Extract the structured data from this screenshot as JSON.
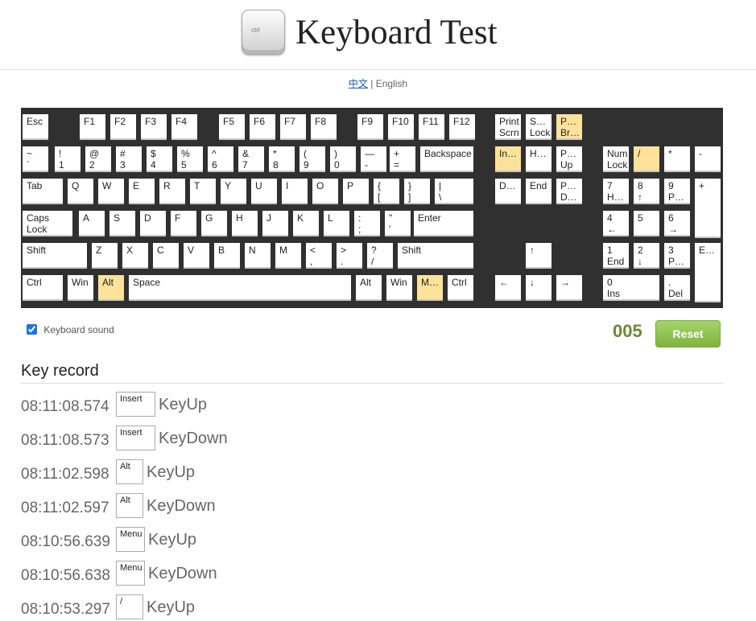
{
  "header": {
    "title": "Keyboard Test",
    "logo_label": "ctrl"
  },
  "lang": {
    "chinese": "中文",
    "separator": "|",
    "english": "English"
  },
  "keys": [
    {
      "id": "esc",
      "l1": "Esc",
      "l2": "",
      "hl": false
    },
    {
      "id": "f1",
      "l1": "F1",
      "l2": "",
      "hl": false
    },
    {
      "id": "f2",
      "l1": "F2",
      "l2": "",
      "hl": false
    },
    {
      "id": "f3",
      "l1": "F3",
      "l2": "",
      "hl": false
    },
    {
      "id": "f4",
      "l1": "F4",
      "l2": "",
      "hl": false
    },
    {
      "id": "f5",
      "l1": "F5",
      "l2": "",
      "hl": false
    },
    {
      "id": "f6",
      "l1": "F6",
      "l2": "",
      "hl": false
    },
    {
      "id": "f7",
      "l1": "F7",
      "l2": "",
      "hl": false
    },
    {
      "id": "f8",
      "l1": "F8",
      "l2": "",
      "hl": false
    },
    {
      "id": "f9",
      "l1": "F9",
      "l2": "",
      "hl": false
    },
    {
      "id": "f10",
      "l1": "F10",
      "l2": "",
      "hl": false
    },
    {
      "id": "f11",
      "l1": "F11",
      "l2": "",
      "hl": false
    },
    {
      "id": "f12",
      "l1": "F12",
      "l2": "",
      "hl": false
    },
    {
      "id": "print-screen",
      "l1": "Print",
      "l2": "Scrn",
      "hl": false
    },
    {
      "id": "scroll-lock",
      "l1": "S…",
      "l2": "Lock",
      "hl": false
    },
    {
      "id": "pause-break",
      "l1": "P…",
      "l2": "Br…",
      "hl": true
    },
    {
      "id": "backtick",
      "l1": "~",
      "l2": "`",
      "hl": false
    },
    {
      "id": "digit-1",
      "l1": "!",
      "l2": "1",
      "hl": false
    },
    {
      "id": "digit-2",
      "l1": "@",
      "l2": "2",
      "hl": false
    },
    {
      "id": "digit-3",
      "l1": "#",
      "l2": "3",
      "hl": false
    },
    {
      "id": "digit-4",
      "l1": "$",
      "l2": "4",
      "hl": false
    },
    {
      "id": "digit-5",
      "l1": "%",
      "l2": "5",
      "hl": false
    },
    {
      "id": "digit-6",
      "l1": "^",
      "l2": "6",
      "hl": false
    },
    {
      "id": "digit-7",
      "l1": "&",
      "l2": "7",
      "hl": false
    },
    {
      "id": "digit-8",
      "l1": "*",
      "l2": "8",
      "hl": false
    },
    {
      "id": "digit-9",
      "l1": "(",
      "l2": "9",
      "hl": false
    },
    {
      "id": "digit-0",
      "l1": ")",
      "l2": "0",
      "hl": false
    },
    {
      "id": "minus",
      "l1": "—",
      "l2": "-",
      "hl": false
    },
    {
      "id": "equal",
      "l1": "+",
      "l2": "=",
      "hl": false
    },
    {
      "id": "backspace",
      "l1": "Backspace",
      "l2": "",
      "hl": false
    },
    {
      "id": "insert",
      "l1": "In…",
      "l2": "",
      "hl": true
    },
    {
      "id": "home",
      "l1": "H…",
      "l2": "",
      "hl": false
    },
    {
      "id": "page-up",
      "l1": "P…",
      "l2": "Up",
      "hl": false
    },
    {
      "id": "num-lock",
      "l1": "Num",
      "l2": "Lock",
      "hl": false
    },
    {
      "id": "numpad-divide",
      "l1": "/",
      "l2": "",
      "hl": true
    },
    {
      "id": "numpad-multiply",
      "l1": "*",
      "l2": "",
      "hl": false
    },
    {
      "id": "numpad-subtract",
      "l1": "-",
      "l2": "",
      "hl": false
    },
    {
      "id": "tab",
      "l1": "Tab",
      "l2": "",
      "hl": false
    },
    {
      "id": "q",
      "l1": "Q",
      "l2": "",
      "hl": false
    },
    {
      "id": "w",
      "l1": "W",
      "l2": "",
      "hl": false
    },
    {
      "id": "e",
      "l1": "E",
      "l2": "",
      "hl": false
    },
    {
      "id": "r",
      "l1": "R",
      "l2": "",
      "hl": false
    },
    {
      "id": "t",
      "l1": "T",
      "l2": "",
      "hl": false
    },
    {
      "id": "y",
      "l1": "Y",
      "l2": "",
      "hl": false
    },
    {
      "id": "u",
      "l1": "U",
      "l2": "",
      "hl": false
    },
    {
      "id": "i",
      "l1": "I",
      "l2": "",
      "hl": false
    },
    {
      "id": "o",
      "l1": "O",
      "l2": "",
      "hl": false
    },
    {
      "id": "p",
      "l1": "P",
      "l2": "",
      "hl": false
    },
    {
      "id": "bracket-left",
      "l1": "{",
      "l2": "[",
      "hl": false
    },
    {
      "id": "bracket-right",
      "l1": "}",
      "l2": "]",
      "hl": false
    },
    {
      "id": "backslash",
      "l1": "|",
      "l2": "\\",
      "hl": false
    },
    {
      "id": "delete",
      "l1": "D…",
      "l2": "",
      "hl": false
    },
    {
      "id": "end",
      "l1": "End",
      "l2": "",
      "hl": false
    },
    {
      "id": "page-down",
      "l1": "P…",
      "l2": "D…",
      "hl": false
    },
    {
      "id": "numpad-7",
      "l1": "7",
      "l2": "H…",
      "hl": false
    },
    {
      "id": "numpad-8",
      "l1": "8",
      "l2": "↑",
      "hl": false
    },
    {
      "id": "numpad-9",
      "l1": "9",
      "l2": "P…",
      "hl": false
    },
    {
      "id": "numpad-add",
      "l1": "+",
      "l2": "",
      "hl": false
    },
    {
      "id": "caps-lock",
      "l1": "Caps",
      "l2": "Lock",
      "hl": false
    },
    {
      "id": "a",
      "l1": "A",
      "l2": "",
      "hl": false
    },
    {
      "id": "s",
      "l1": "S",
      "l2": "",
      "hl": false
    },
    {
      "id": "d",
      "l1": "D",
      "l2": "",
      "hl": false
    },
    {
      "id": "f",
      "l1": "F",
      "l2": "",
      "hl": false
    },
    {
      "id": "g",
      "l1": "G",
      "l2": "",
      "hl": false
    },
    {
      "id": "h",
      "l1": "H",
      "l2": "",
      "hl": false
    },
    {
      "id": "j",
      "l1": "J",
      "l2": "",
      "hl": false
    },
    {
      "id": "k",
      "l1": "K",
      "l2": "",
      "hl": false
    },
    {
      "id": "l",
      "l1": "L",
      "l2": "",
      "hl": false
    },
    {
      "id": "semicolon",
      "l1": ":",
      "l2": ";",
      "hl": false
    },
    {
      "id": "quote",
      "l1": "\"",
      "l2": "'",
      "hl": false
    },
    {
      "id": "enter",
      "l1": "Enter",
      "l2": "",
      "hl": false
    },
    {
      "id": "numpad-4",
      "l1": "4",
      "l2": "←",
      "hl": false
    },
    {
      "id": "numpad-5",
      "l1": "5",
      "l2": "",
      "hl": false
    },
    {
      "id": "numpad-6",
      "l1": "6",
      "l2": "→",
      "hl": false
    },
    {
      "id": "shift-left",
      "l1": "Shift",
      "l2": "",
      "hl": false
    },
    {
      "id": "z",
      "l1": "Z",
      "l2": "",
      "hl": false
    },
    {
      "id": "x",
      "l1": "X",
      "l2": "",
      "hl": false
    },
    {
      "id": "c",
      "l1": "C",
      "l2": "",
      "hl": false
    },
    {
      "id": "v",
      "l1": "V",
      "l2": "",
      "hl": false
    },
    {
      "id": "b",
      "l1": "B",
      "l2": "",
      "hl": false
    },
    {
      "id": "n",
      "l1": "N",
      "l2": "",
      "hl": false
    },
    {
      "id": "m",
      "l1": "M",
      "l2": "",
      "hl": false
    },
    {
      "id": "comma",
      "l1": "<",
      "l2": ",",
      "hl": false
    },
    {
      "id": "period",
      "l1": ">",
      "l2": ".",
      "hl": false
    },
    {
      "id": "slash",
      "l1": "?",
      "l2": "/",
      "hl": false
    },
    {
      "id": "shift-right",
      "l1": "Shift",
      "l2": "",
      "hl": false
    },
    {
      "id": "arrow-up",
      "l1": "↑",
      "l2": "",
      "hl": false
    },
    {
      "id": "numpad-1",
      "l1": "1",
      "l2": "End",
      "hl": false
    },
    {
      "id": "numpad-2",
      "l1": "2",
      "l2": "↓",
      "hl": false
    },
    {
      "id": "numpad-3",
      "l1": "3",
      "l2": "P…",
      "hl": false
    },
    {
      "id": "numpad-enter",
      "l1": "E…",
      "l2": "",
      "hl": false
    },
    {
      "id": "ctrl-left",
      "l1": "Ctrl",
      "l2": "",
      "hl": false
    },
    {
      "id": "win-left",
      "l1": "Win",
      "l2": "",
      "hl": false
    },
    {
      "id": "alt-left",
      "l1": "Alt",
      "l2": "",
      "hl": true
    },
    {
      "id": "space",
      "l1": "Space",
      "l2": "",
      "hl": false
    },
    {
      "id": "alt-right",
      "l1": "Alt",
      "l2": "",
      "hl": false
    },
    {
      "id": "win-right",
      "l1": "Win",
      "l2": "",
      "hl": false
    },
    {
      "id": "menu",
      "l1": "M…",
      "l2": "",
      "hl": true
    },
    {
      "id": "ctrl-right",
      "l1": "Ctrl",
      "l2": "",
      "hl": false
    },
    {
      "id": "arrow-left",
      "l1": "←",
      "l2": "",
      "hl": false
    },
    {
      "id": "arrow-down",
      "l1": "↓",
      "l2": "",
      "hl": false
    },
    {
      "id": "arrow-right",
      "l1": "→",
      "l2": "",
      "hl": false
    },
    {
      "id": "numpad-0",
      "l1": "0",
      "l2": "Ins",
      "hl": false
    },
    {
      "id": "numpad-decimal",
      "l1": ".",
      "l2": "Del",
      "hl": false
    }
  ],
  "controls": {
    "sound_label": "Keyboard sound",
    "sound_checked": true,
    "counter": "005",
    "reset_label": "Reset"
  },
  "record": {
    "title": "Key record",
    "entries": [
      {
        "time": "08:11:08.574",
        "key": "Insert",
        "action": "KeyUp"
      },
      {
        "time": "08:11:08.573",
        "key": "Insert",
        "action": "KeyDown"
      },
      {
        "time": "08:11:02.598",
        "key": "Alt",
        "action": "KeyUp"
      },
      {
        "time": "08:11:02.597",
        "key": "Alt",
        "action": "KeyDown"
      },
      {
        "time": "08:10:56.639",
        "key": "Menu",
        "action": "KeyUp"
      },
      {
        "time": "08:10:56.638",
        "key": "Menu",
        "action": "KeyDown"
      },
      {
        "time": "08:10:53.297",
        "key": "/",
        "action": "KeyUp"
      }
    ]
  },
  "colors": {
    "highlight": "#fde29a",
    "keyboard_bg": "#303030",
    "reset_green": "#8bc34a",
    "counter_green": "#6a8a2e"
  }
}
